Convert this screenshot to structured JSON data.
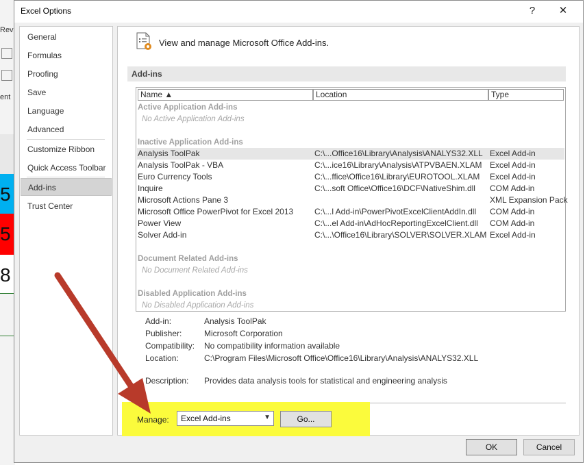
{
  "background": {
    "tab_fragment": "Revie",
    "side_fragment": "ent",
    "cells": [
      {
        "text": "5",
        "color": "#00b0f0"
      },
      {
        "text": "5",
        "color": "#ff0000"
      },
      {
        "text": "8",
        "color": "#ffffff"
      }
    ]
  },
  "dialog": {
    "title": "Excel Options",
    "help_label": "?",
    "close_label": "✕"
  },
  "sidebar": {
    "items": [
      {
        "label": "General"
      },
      {
        "label": "Formulas"
      },
      {
        "label": "Proofing"
      },
      {
        "label": "Save"
      },
      {
        "label": "Language"
      },
      {
        "label": "Advanced"
      },
      {
        "label": "Customize Ribbon"
      },
      {
        "label": "Quick Access Toolbar"
      },
      {
        "label": "Add-ins",
        "active": true
      },
      {
        "label": "Trust Center"
      }
    ]
  },
  "content": {
    "header": "View and manage Microsoft Office Add-ins.",
    "section_title": "Add-ins",
    "columns": {
      "name": "Name ▲",
      "location": "Location",
      "type": "Type"
    },
    "groups": {
      "active": {
        "title": "Active Application Add-ins",
        "empty": "No Active Application Add-ins"
      },
      "inactive": {
        "title": "Inactive Application Add-ins"
      },
      "document": {
        "title": "Document Related Add-ins",
        "empty": "No Document Related Add-ins"
      },
      "disabled": {
        "title": "Disabled Application Add-ins",
        "empty": "No Disabled Application Add-ins"
      }
    },
    "rows": [
      {
        "name": "Analysis ToolPak",
        "location": "C:\\...Office16\\Library\\Analysis\\ANALYS32.XLL",
        "type": "Excel Add-in",
        "selected": true
      },
      {
        "name": "Analysis ToolPak - VBA",
        "location": "C:\\...ice16\\Library\\Analysis\\ATPVBAEN.XLAM",
        "type": "Excel Add-in"
      },
      {
        "name": "Euro Currency Tools",
        "location": "C:\\...ffice\\Office16\\Library\\EUROTOOL.XLAM",
        "type": "Excel Add-in"
      },
      {
        "name": "Inquire",
        "location": "C:\\...soft Office\\Office16\\DCF\\NativeShim.dll",
        "type": "COM Add-in"
      },
      {
        "name": "Microsoft Actions Pane 3",
        "location": "",
        "type": "XML Expansion Pack"
      },
      {
        "name": "Microsoft Office PowerPivot for Excel 2013",
        "location": "C:\\...l Add-in\\PowerPivotExcelClientAddIn.dll",
        "type": "COM Add-in"
      },
      {
        "name": "Power View",
        "location": "C:\\...el Add-in\\AdHocReportingExcelClient.dll",
        "type": "COM Add-in"
      },
      {
        "name": "Solver Add-in",
        "location": "C:\\...\\Office16\\Library\\SOLVER\\SOLVER.XLAM",
        "type": "Excel Add-in"
      }
    ],
    "details": {
      "addin_label": "Add-in:",
      "addin_value": "Analysis ToolPak",
      "publisher_label": "Publisher:",
      "publisher_value": "Microsoft Corporation",
      "compat_label": "Compatibility:",
      "compat_value": "No compatibility information available",
      "location_label": "Location:",
      "location_value": "C:\\Program Files\\Microsoft Office\\Office16\\Library\\Analysis\\ANALYS32.XLL",
      "description_label": "Description:",
      "description_value": "Provides data analysis tools for statistical and engineering analysis"
    },
    "manage": {
      "label": "Manage:",
      "selected": "Excel Add-ins",
      "go_label": "Go..."
    }
  },
  "footer": {
    "ok_label": "OK",
    "cancel_label": "Cancel"
  },
  "annotations": {
    "highlight_color": "#fbfb3c",
    "arrow_color": "#b83a2a"
  }
}
